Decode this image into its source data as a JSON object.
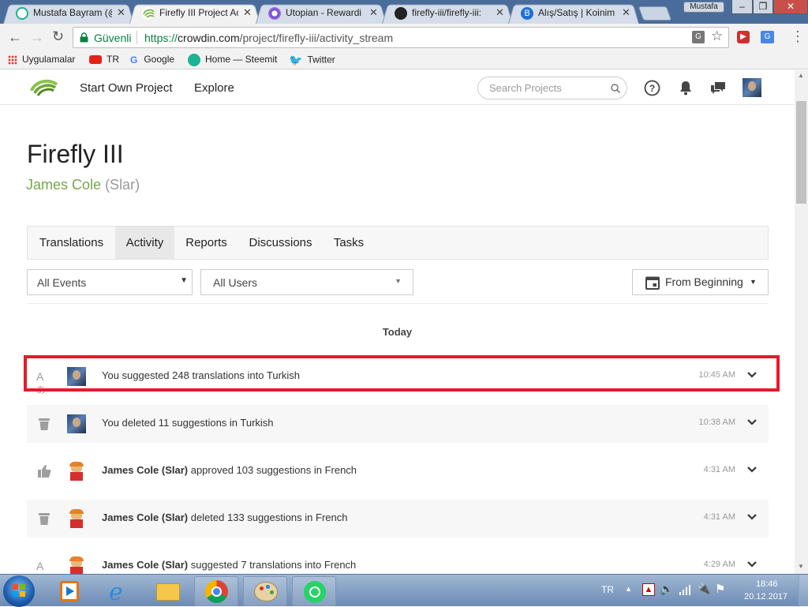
{
  "browser": {
    "tabs": [
      {
        "title": "Mustafa Bayram (@",
        "favicon_color": "#1ab394"
      },
      {
        "title": "Firefly III Project Ac",
        "favicon_color": "#7cb342",
        "active": true
      },
      {
        "title": "Utopian - Rewardi",
        "favicon_color": "#5b4bdb"
      },
      {
        "title": "firefly-iii/firefly-iii:",
        "favicon_color": "#222222"
      },
      {
        "title": "Alış/Satış | Koinim",
        "favicon_color": "#1f6fd1"
      }
    ],
    "window_user": "Mustafa",
    "security_label": "Güvenli",
    "url_prefix": "https://",
    "url_host": "crowdin.com",
    "url_path": "/project/firefly-iii/activity_stream",
    "bookmarks": [
      {
        "label": "Uygulamalar",
        "icon": "apps-grid-icon"
      },
      {
        "label": "TR",
        "icon": "youtube-icon"
      },
      {
        "label": "Google",
        "icon": "google-icon"
      },
      {
        "label": "Home — Steemit",
        "icon": "steemit-icon"
      },
      {
        "label": "Twitter",
        "icon": "twitter-icon"
      }
    ]
  },
  "site": {
    "nav": {
      "start_project": "Start Own Project",
      "explore": "Explore"
    },
    "search_placeholder": "Search Projects",
    "brand_color": "#78a54b"
  },
  "project": {
    "title": "Firefly III",
    "owner_name": "James Cole",
    "owner_handle": "(Slar)",
    "tabs": [
      "Translations",
      "Activity",
      "Reports",
      "Discussions",
      "Tasks"
    ],
    "active_tab": "Activity"
  },
  "filters": {
    "events": "All Events",
    "users": "All Users",
    "period": "From Beginning"
  },
  "activity": {
    "day_label": "Today",
    "items": [
      {
        "icon": "translate-icon",
        "actor": "",
        "text": "You suggested 248 translations into Turkish",
        "time": "10:45 AM",
        "avatar": "user"
      },
      {
        "icon": "trash-icon",
        "actor": "",
        "text": "You deleted 11 suggestions in Turkish",
        "time": "10:38 AM",
        "avatar": "user"
      },
      {
        "icon": "thumbs-up-icon",
        "actor": "James Cole (Slar)",
        "text": " approved 103 suggestions in French",
        "time": "4:31 AM",
        "avatar": "cartoon"
      },
      {
        "icon": "trash-icon",
        "actor": "James Cole (Slar)",
        "text": " deleted 133 suggestions in French",
        "time": "4:31 AM",
        "avatar": "cartoon"
      },
      {
        "icon": "translate-icon",
        "actor": "James Cole (Slar)",
        "text": " suggested 7 translations into French",
        "time": "4:29 AM",
        "avatar": "cartoon"
      }
    ]
  },
  "taskbar": {
    "language": "TR",
    "time": "18:46",
    "date": "20.12.2017"
  }
}
